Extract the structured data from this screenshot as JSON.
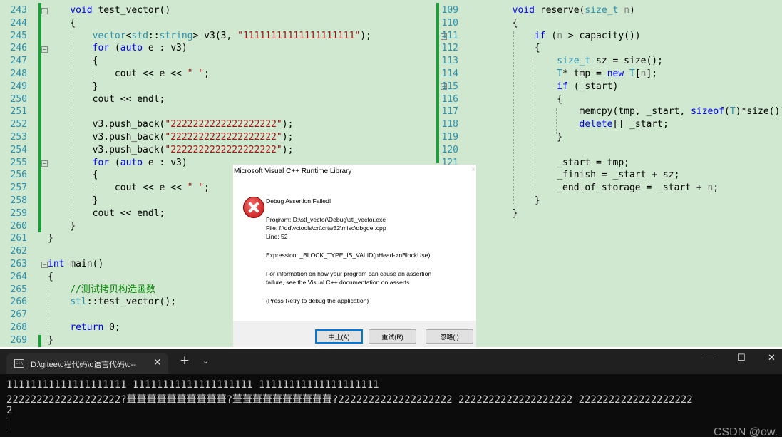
{
  "editor_left": {
    "lines": [
      {
        "n": "243",
        "html": "    <span class='kw'>void</span> test_vector()"
      },
      {
        "n": "244",
        "html": "    {"
      },
      {
        "n": "245",
        "html": "        <span class='ty'>vector</span>&lt;<span class='ty'>std</span>::<span class='ty'>string</span>&gt; v3(3, <span class='str'>\"11111111111111111111\"</span>);"
      },
      {
        "n": "246",
        "html": "        <span class='kw'>for</span> (<span class='kw'>auto</span> e : v3)"
      },
      {
        "n": "247",
        "html": "        {"
      },
      {
        "n": "248",
        "html": "            cout &lt;&lt; e &lt;&lt; <span class='str'>\" \"</span>;"
      },
      {
        "n": "249",
        "html": "        }"
      },
      {
        "n": "250",
        "html": "        cout &lt;&lt; endl;"
      },
      {
        "n": "251",
        "html": ""
      },
      {
        "n": "252",
        "html": "        v3.push_back(<span class='str'>\"2222222222222222222\"</span>);"
      },
      {
        "n": "253",
        "html": "        v3.push_back(<span class='str'>\"2222222222222222222\"</span>);"
      },
      {
        "n": "254",
        "html": "        v3.push_back(<span class='str'>\"2222222222222222222\"</span>);"
      },
      {
        "n": "255",
        "html": "        <span class='kw'>for</span> (<span class='kw'>auto</span> e : v3)"
      },
      {
        "n": "256",
        "html": "        {"
      },
      {
        "n": "257",
        "html": "            cout &lt;&lt; e &lt;&lt; <span class='str'>\" \"</span>;"
      },
      {
        "n": "258",
        "html": "        }"
      },
      {
        "n": "259",
        "html": "        cout &lt;&lt; endl;"
      },
      {
        "n": "260",
        "html": "    }"
      },
      {
        "n": "261",
        "html": "}"
      },
      {
        "n": "262",
        "html": ""
      },
      {
        "n": "263",
        "html": "<span class='kw'>int</span> main()"
      },
      {
        "n": "264",
        "html": "{"
      },
      {
        "n": "265",
        "html": "    <span class='cmt'>//测试拷贝构造函数</span>"
      },
      {
        "n": "266",
        "html": "    <span class='ty'>stl</span>::test_vector();"
      },
      {
        "n": "267",
        "html": ""
      },
      {
        "n": "268",
        "html": "    <span class='kw'>return</span> 0;"
      },
      {
        "n": "269",
        "html": "}"
      }
    ]
  },
  "editor_right": {
    "lines": [
      {
        "n": "109",
        "html": "        <span class='kw'>void</span> reserve(<span class='ty'>size_t</span> <span class='pm'>n</span>)"
      },
      {
        "n": "110",
        "html": "        {"
      },
      {
        "n": "111",
        "html": "            <span class='kw'>if</span> (<span class='pm'>n</span> &gt; capacity())"
      },
      {
        "n": "112",
        "html": "            {"
      },
      {
        "n": "113",
        "html": "                <span class='ty'>size_t</span> sz = size();"
      },
      {
        "n": "114",
        "html": "                <span class='ty'>T</span>* tmp = <span class='kw'>new</span> <span class='ty'>T</span>[<span class='pm'>n</span>];"
      },
      {
        "n": "115",
        "html": "                <span class='kw'>if</span> (_start)"
      },
      {
        "n": "116",
        "html": "                {"
      },
      {
        "n": "117",
        "html": "                    memcpy(tmp, _start, <span class='kw'>sizeof</span>(<span class='ty'>T</span>)*size());"
      },
      {
        "n": "118",
        "html": "                    <span class='kw'>delete</span>[] _start;"
      },
      {
        "n": "119",
        "html": "                }"
      },
      {
        "n": "120",
        "html": ""
      },
      {
        "n": "121",
        "html": "                _start = tmp;"
      },
      {
        "n": "",
        "html": "                _finish = _start + sz;"
      },
      {
        "n": "",
        "html": "                _end_of_storage = _start + <span class='pm'>n</span>;"
      },
      {
        "n": "",
        "html": "            }"
      },
      {
        "n": "",
        "html": "        }"
      }
    ]
  },
  "dialog": {
    "title": "Microsoft Visual C++ Runtime Library",
    "close_glyph": "×",
    "heading": "Debug Assertion Failed!",
    "program": "Program: D:\\stl_vector\\Debug\\stl_vector.exe",
    "file": "File: f:\\dd\\vctools\\crt\\crtw32\\misc\\dbgdel.cpp",
    "line": "Line: 52",
    "expression": "Expression: _BLOCK_TYPE_IS_VALID(pHead->nBlockUse)",
    "info_1": "For information on how your program can cause an assertion",
    "info_2": "failure, see the Visual C++ documentation on asserts.",
    "hint": "(Press Retry to debug the application)",
    "buttons": {
      "abort": "中止(A)",
      "retry": "重试(R)",
      "ignore": "忽略(I)"
    }
  },
  "terminal": {
    "tab_icon_text": "C:\\",
    "tab_title": "D:\\gitee\\c程代码\\c语言代码\\c--",
    "tab_close": "✕",
    "new_tab": "+",
    "dropdown": "⌄",
    "minimize": "—",
    "maximize": "☐",
    "close": "✕",
    "output": [
      "11111111111111111111 11111111111111111111 11111111111111111111",
      "2222222222222222222?葺葺葺葺葺葺葺葺葺葺?葺葺葺葺葺葺葺葺葺葺?2222222222222222222 2222222222222222222 2222222222222222222",
      "2"
    ]
  },
  "watermark": "CSDN @ow."
}
